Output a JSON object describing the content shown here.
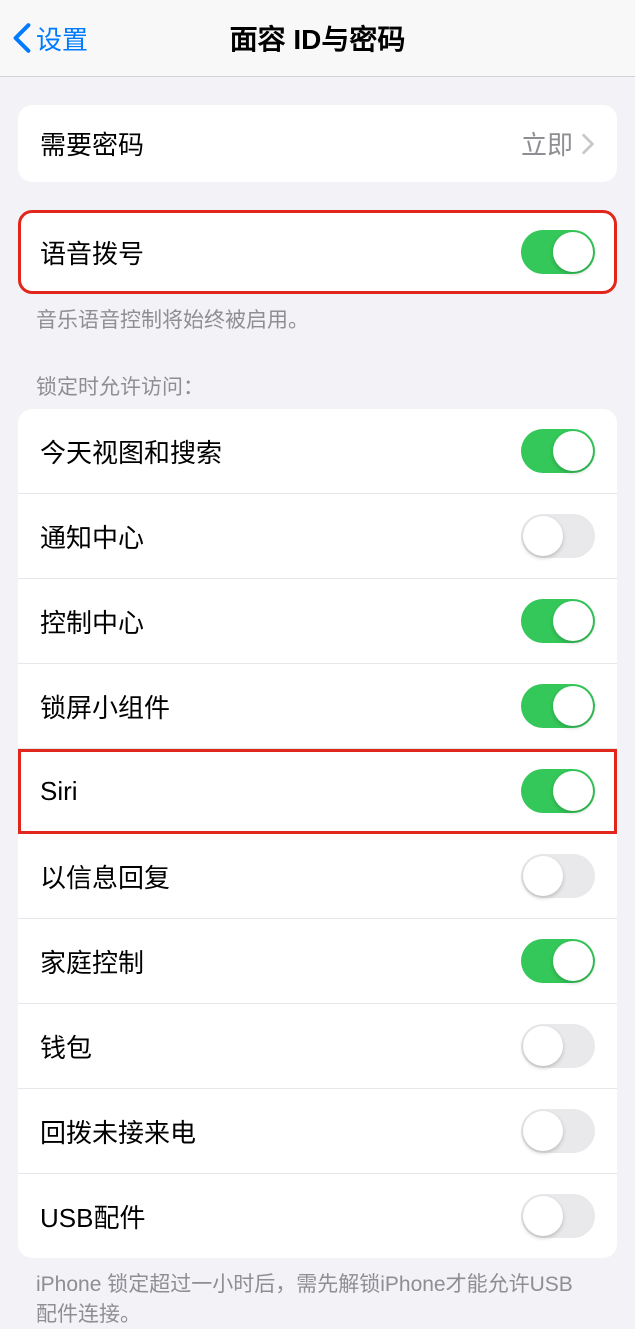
{
  "header": {
    "back_label": "设置",
    "title": "面容 ID与密码"
  },
  "passcode_group": {
    "require_passcode_label": "需要密码",
    "require_passcode_value": "立即"
  },
  "voice_dial": {
    "label": "语音拨号",
    "enabled": true,
    "footer": "音乐语音控制将始终被启用。"
  },
  "lock_access": {
    "header": "锁定时允许访问：",
    "items": [
      {
        "label": "今天视图和搜索",
        "enabled": true
      },
      {
        "label": "通知中心",
        "enabled": false
      },
      {
        "label": "控制中心",
        "enabled": true
      },
      {
        "label": "锁屏小组件",
        "enabled": true
      },
      {
        "label": "Siri",
        "enabled": true
      },
      {
        "label": "以信息回复",
        "enabled": false
      },
      {
        "label": "家庭控制",
        "enabled": true
      },
      {
        "label": "钱包",
        "enabled": false
      },
      {
        "label": "回拨未接来电",
        "enabled": false
      },
      {
        "label": "USB配件",
        "enabled": false
      }
    ],
    "footer": "iPhone 锁定超过一小时后，需先解锁iPhone才能允许USB 配件连接。"
  }
}
